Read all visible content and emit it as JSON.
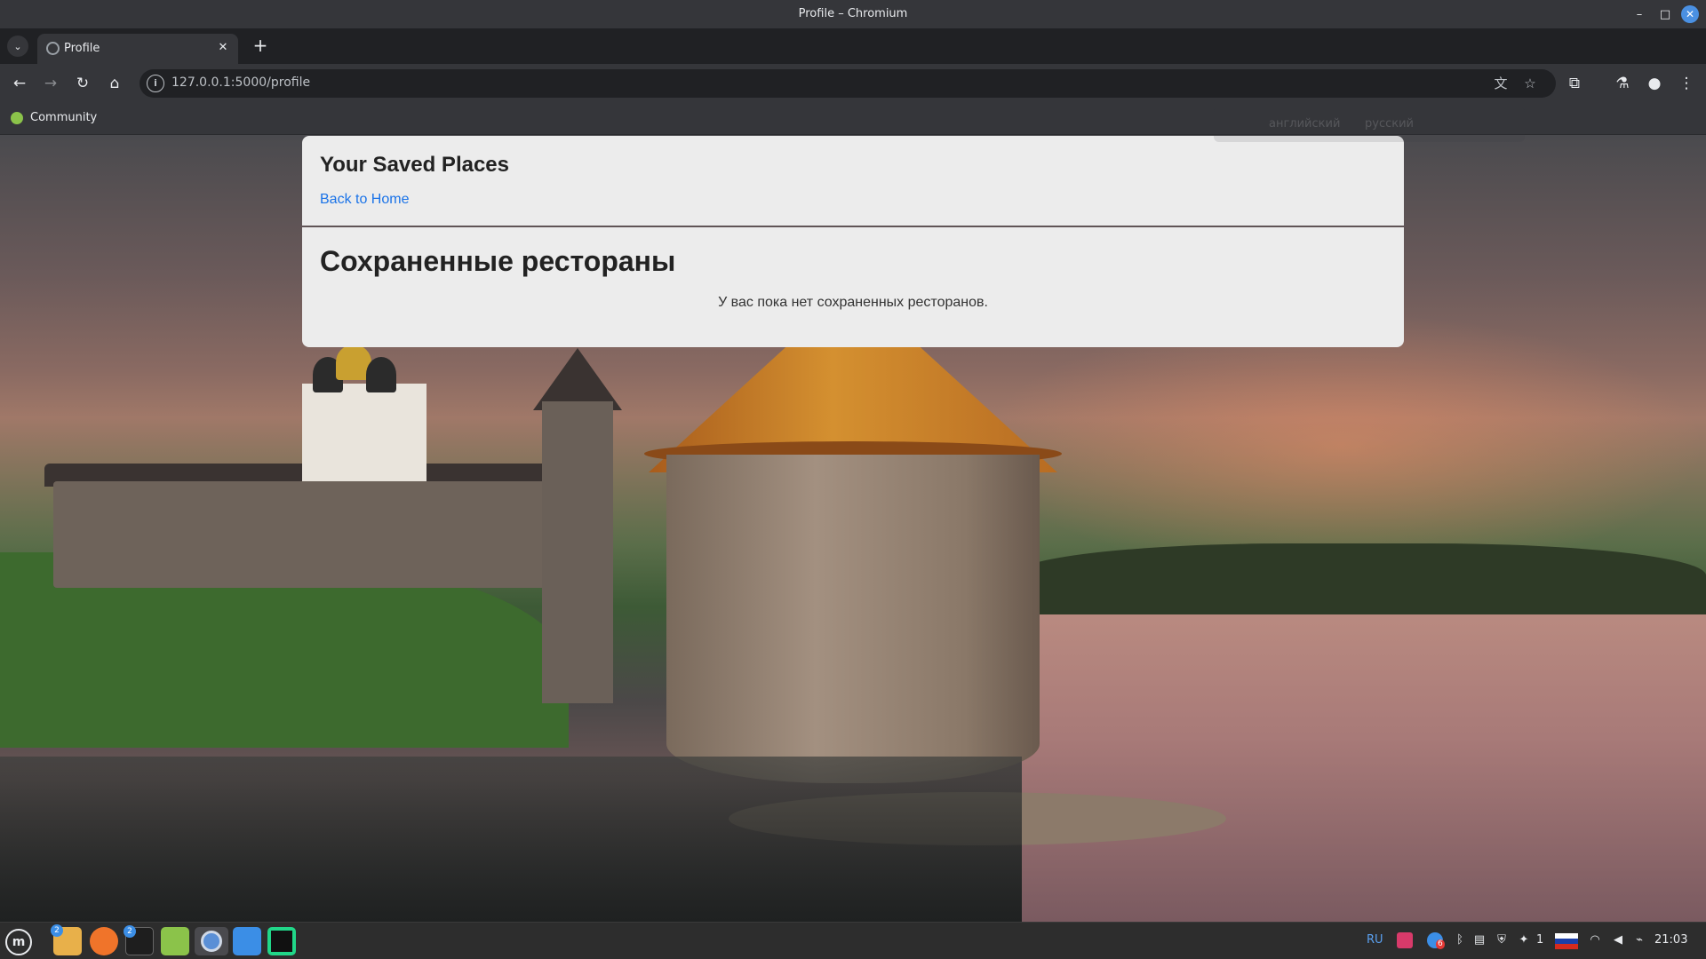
{
  "window": {
    "title": "Profile – Chromium",
    "minimize_glyph": "–",
    "maximize_glyph": "□",
    "close_glyph": "✕"
  },
  "tabs": [
    {
      "label": "Profile",
      "close_glyph": "✕"
    }
  ],
  "new_tab_glyph": "+",
  "tab_search_glyph": "⌄",
  "toolbar": {
    "back_glyph": "←",
    "forward_glyph": "→",
    "reload_glyph": "↻",
    "home_glyph": "⌂",
    "url": "127.0.0.1:5000/profile",
    "info_glyph": "i",
    "translate_glyph": "文",
    "bookmark_star_glyph": "☆",
    "extensions_glyph": "⧉",
    "labs_glyph": "⚗",
    "profile_glyph": "●",
    "menu_glyph": "⋮"
  },
  "bookmarks": [
    {
      "label": "Community"
    }
  ],
  "translate_popup": {
    "source_language": "английский",
    "target_language": "русский"
  },
  "page": {
    "heading": "Your Saved Places",
    "back_link": "Back to Home",
    "section_heading": "Сохраненные рестораны",
    "empty_message": "У вас пока нет сохраненных ресторанов."
  },
  "taskbar": {
    "menu_glyph": "m",
    "apps": [
      {
        "name": "files",
        "color": "#e8b04a",
        "badge": "2"
      },
      {
        "name": "firefox",
        "color": "#f0742a",
        "badge": ""
      },
      {
        "name": "terminal",
        "color": "#1e1e1e",
        "badge": "2"
      },
      {
        "name": "mintinstall",
        "color": "#8bc34a",
        "badge": ""
      },
      {
        "name": "chromium",
        "color": "#5a8fd6",
        "badge": ""
      },
      {
        "name": "text-editor",
        "color": "#3b8ee6",
        "badge": ""
      },
      {
        "name": "pycharm",
        "color": "#21d789",
        "badge": ""
      }
    ],
    "keyboard_layout": "RU",
    "notification_count": "6",
    "updates_count": "1",
    "clock": "21:03"
  },
  "colors": {
    "accent": "#1a73e8",
    "chrome_dark": "#35363a",
    "card_background": "#ececec"
  }
}
